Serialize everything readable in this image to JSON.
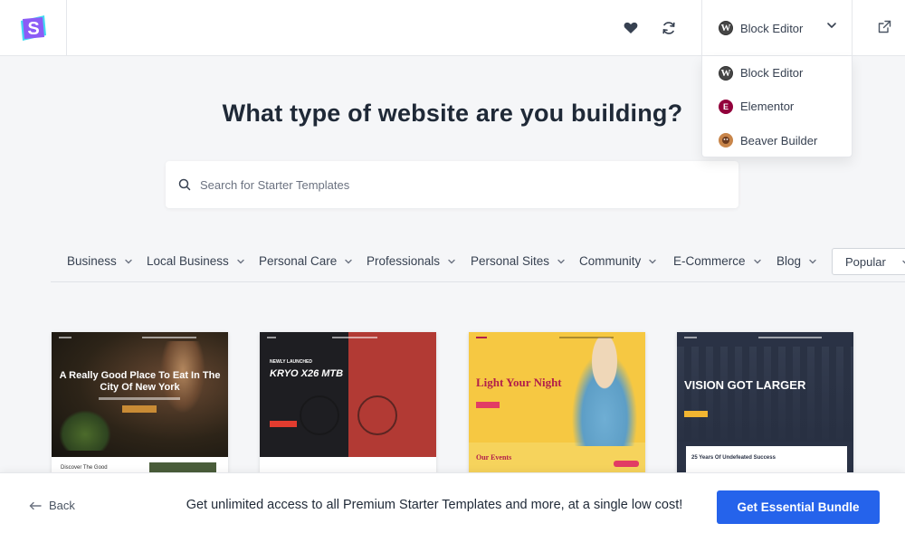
{
  "header": {
    "logo_icon": "starter-templates-logo",
    "favorites_icon": "heart-icon",
    "sync_icon": "refresh-icon",
    "builder_selected": "Block Editor",
    "external_icon": "external-link-icon",
    "brand_colors": {
      "logo_primary": "#7c3aed",
      "logo_secondary": "#22d3ee"
    }
  },
  "builder_menu": {
    "items": [
      {
        "label": "Block Editor",
        "icon": "wordpress-icon"
      },
      {
        "label": "Elementor",
        "icon": "elementor-icon"
      },
      {
        "label": "Beaver Builder",
        "icon": "beaver-builder-icon"
      }
    ]
  },
  "main": {
    "title": "What type of website are you building?",
    "search_placeholder": "Search for Starter Templates"
  },
  "categories": [
    "Business",
    "Local Business",
    "Personal Care",
    "Professionals",
    "Personal Sites",
    "Community",
    "E-Commerce",
    "Blog"
  ],
  "sort": {
    "selected": "Popular"
  },
  "templates": [
    {
      "headline": "A Really Good Place To Eat In The City Of New York",
      "caption": "Discover The Good"
    },
    {
      "headline": "KRYO X26 MTB",
      "kicker": "NEWLY LAUNCHED"
    },
    {
      "headline": "Light Your Night",
      "section": "Our Events"
    },
    {
      "headline": "VISION GOT LARGER",
      "stat": "25 Years Of Undefeated Success"
    }
  ],
  "footer": {
    "back_label": "Back",
    "promo_text": "Get unlimited access to all Premium Starter Templates and more, at a single low cost!",
    "cta_label": "Get Essential Bundle",
    "cta_color": "#2563eb"
  }
}
